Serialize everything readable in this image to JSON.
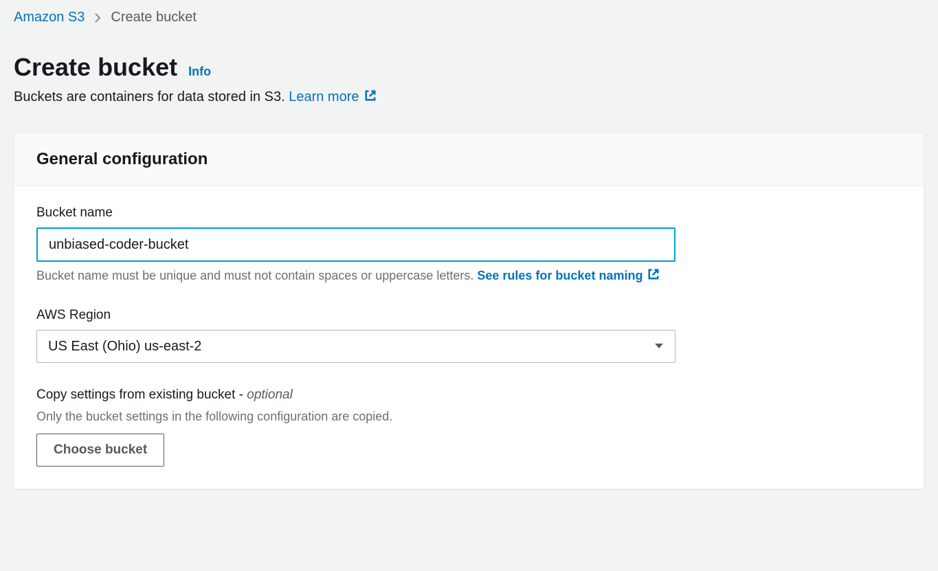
{
  "breadcrumb": {
    "root": "Amazon S3",
    "current": "Create bucket"
  },
  "header": {
    "title": "Create bucket",
    "info": "Info",
    "subtitle_prefix": "Buckets are containers for data stored in S3. ",
    "learn_more": "Learn more"
  },
  "card": {
    "title": "General configuration",
    "bucket_name": {
      "label": "Bucket name",
      "value": "unbiased-coder-bucket",
      "hint": "Bucket name must be unique and must not contain spaces or uppercase letters. ",
      "rules_link": "See rules for bucket naming"
    },
    "region": {
      "label": "AWS Region",
      "selected": "US East (Ohio) us-east-2"
    },
    "copy": {
      "label_prefix": "Copy settings from existing bucket - ",
      "optional": "optional",
      "hint": "Only the bucket settings in the following configuration are copied.",
      "button": "Choose bucket"
    }
  }
}
